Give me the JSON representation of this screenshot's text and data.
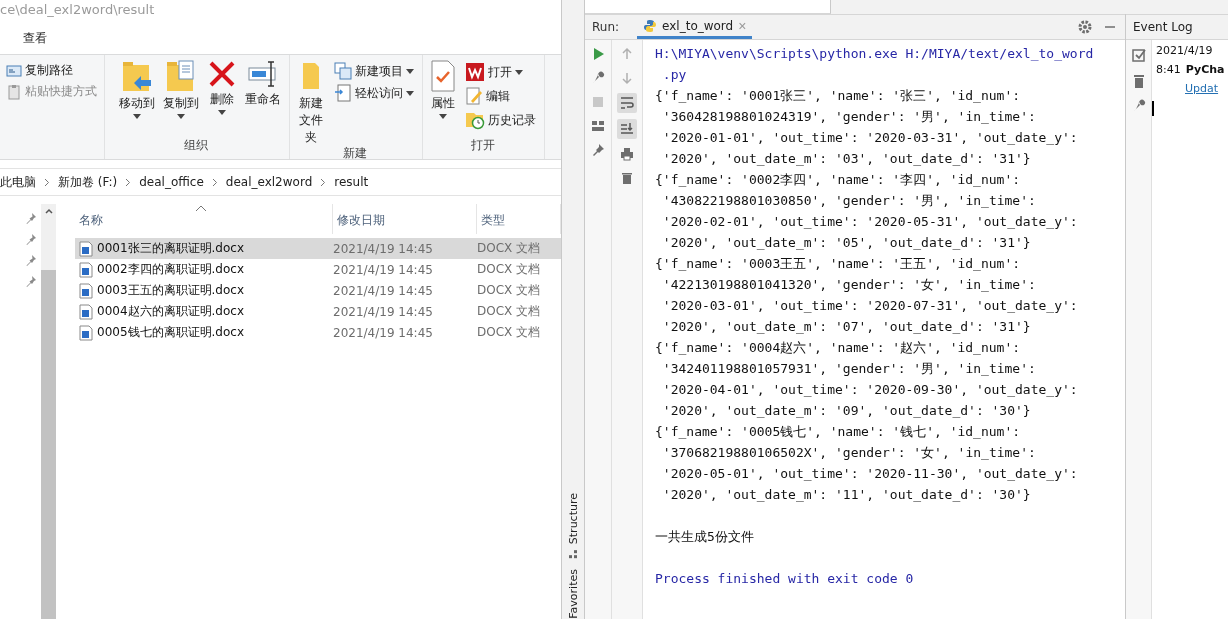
{
  "explorer": {
    "path": "ce\\deal_exl2word\\result",
    "ribbon_tab": "查看",
    "ribbon_groups": [
      {
        "small": [
          {
            "label": "复制路径",
            "disabled": false,
            "dropdown": false
          },
          {
            "label": "粘贴快捷方式",
            "disabled": true,
            "dropdown": false
          }
        ]
      },
      {
        "label": "组织",
        "large": [
          {
            "label": "移动到",
            "dropdown": true
          },
          {
            "label": "复制到",
            "dropdown": true
          },
          {
            "label": "删除",
            "dropdown": true
          },
          {
            "label": "重命名",
            "dropdown": false
          }
        ]
      },
      {
        "label": "新建",
        "large": [
          {
            "label": "新建文件夹",
            "dropdown": false
          }
        ],
        "small": [
          {
            "label": "新建项目",
            "disabled": false,
            "dropdown": true
          },
          {
            "label": "轻松访问",
            "disabled": false,
            "dropdown": true
          }
        ]
      },
      {
        "label": "打开",
        "large": [
          {
            "label": "属性",
            "dropdown": true
          }
        ],
        "small": [
          {
            "label": "打开",
            "disabled": false,
            "dropdown": true
          },
          {
            "label": "编辑",
            "disabled": false,
            "dropdown": false
          },
          {
            "label": "历史记录",
            "disabled": false,
            "dropdown": false
          }
        ]
      }
    ],
    "breadcrumb": [
      "此电脑",
      "新加卷 (F:)",
      "deal_office",
      "deal_exl2word",
      "result"
    ],
    "columns": [
      "名称",
      "修改日期",
      "类型"
    ],
    "files": [
      {
        "name": "0001张三的离职证明.docx",
        "modified": "2021/4/19 14:45",
        "type": "DOCX 文档",
        "selected": true
      },
      {
        "name": "0002李四的离职证明.docx",
        "modified": "2021/4/19 14:45",
        "type": "DOCX 文档",
        "selected": false
      },
      {
        "name": "0003王五的离职证明.docx",
        "modified": "2021/4/19 14:45",
        "type": "DOCX 文档",
        "selected": false
      },
      {
        "name": "0004赵六的离职证明.docx",
        "modified": "2021/4/19 14:45",
        "type": "DOCX 文档",
        "selected": false
      },
      {
        "name": "0005钱七的离职证明.docx",
        "modified": "2021/4/19 14:45",
        "type": "DOCX 文档",
        "selected": false
      }
    ]
  },
  "ide": {
    "run_label": "Run:",
    "run_tab": "exl_to_word",
    "close": "×",
    "side_tabs": [
      "Structure",
      "Favorites"
    ],
    "console": [
      {
        "kind": "system",
        "text": "H:\\MIYA\\venv\\Scripts\\python.exe H:/MIYA/text/exl_to_word"
      },
      {
        "kind": "system",
        "text": " .py"
      },
      {
        "kind": "output",
        "text": "{'f_name': '0001张三', 'name': '张三', 'id_num':"
      },
      {
        "kind": "output",
        "text": " '360428198801024319', 'gender': '男', 'in_time':"
      },
      {
        "kind": "output",
        "text": " '2020-01-01', 'out_time': '2020-03-31', 'out_date_y':"
      },
      {
        "kind": "output",
        "text": " '2020', 'out_date_m': '03', 'out_date_d': '31'}"
      },
      {
        "kind": "output",
        "text": "{'f_name': '0002李四', 'name': '李四', 'id_num':"
      },
      {
        "kind": "output",
        "text": " '430822198801030850', 'gender': '男', 'in_time':"
      },
      {
        "kind": "output",
        "text": " '2020-02-01', 'out_time': '2020-05-31', 'out_date_y':"
      },
      {
        "kind": "output",
        "text": " '2020', 'out_date_m': '05', 'out_date_d': '31'}"
      },
      {
        "kind": "output",
        "text": "{'f_name': '0003王五', 'name': '王五', 'id_num':"
      },
      {
        "kind": "output",
        "text": " '422130198801041320', 'gender': '女', 'in_time':"
      },
      {
        "kind": "output",
        "text": " '2020-03-01', 'out_time': '2020-07-31', 'out_date_y':"
      },
      {
        "kind": "output",
        "text": " '2020', 'out_date_m': '07', 'out_date_d': '31'}"
      },
      {
        "kind": "output",
        "text": "{'f_name': '0004赵六', 'name': '赵六', 'id_num':"
      },
      {
        "kind": "output",
        "text": " '342401198801057931', 'gender': '男', 'in_time':"
      },
      {
        "kind": "output",
        "text": " '2020-04-01', 'out_time': '2020-09-30', 'out_date_y':"
      },
      {
        "kind": "output",
        "text": " '2020', 'out_date_m': '09', 'out_date_d': '30'}"
      },
      {
        "kind": "output",
        "text": "{'f_name': '0005钱七', 'name': '钱七', 'id_num':"
      },
      {
        "kind": "output",
        "text": " '37068219880106502X', 'gender': '女', 'in_time':"
      },
      {
        "kind": "output",
        "text": " '2020-05-01', 'out_time': '2020-11-30', 'out_date_y':"
      },
      {
        "kind": "output",
        "text": " '2020', 'out_date_m': '11', 'out_date_d': '30'}"
      },
      {
        "kind": "blank"
      },
      {
        "kind": "output",
        "text": "一共生成5份文件"
      },
      {
        "kind": "blank"
      },
      {
        "kind": "system",
        "text": "Process finished with exit code 0"
      }
    ],
    "event_log": {
      "title": "Event Log",
      "entries": [
        {
          "date": "2021/4/19",
          "time": "8:41",
          "title": "PyCha",
          "link": "Updat"
        }
      ]
    }
  }
}
